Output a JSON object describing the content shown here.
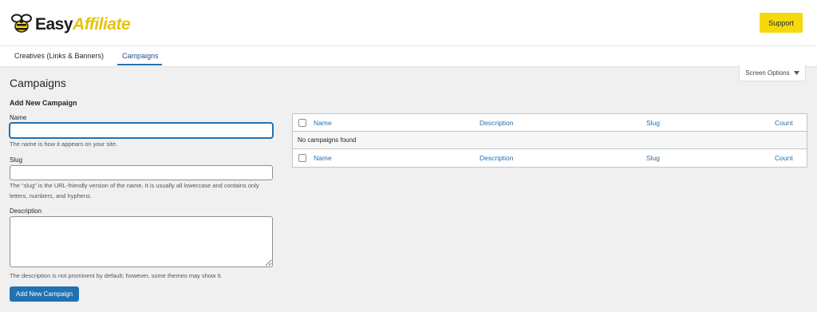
{
  "brand": {
    "logo_easy": "Easy",
    "logo_affiliate": "Affiliate",
    "accent": "#f5d90a",
    "link_color": "#2271b1"
  },
  "header": {
    "support_label": "Support"
  },
  "tabs": [
    {
      "label": "Creatives (Links & Banners)",
      "active": false
    },
    {
      "label": "Campaigns",
      "active": true
    }
  ],
  "screen_options": {
    "label": "Screen Options",
    "icon": "caret-down-icon"
  },
  "page": {
    "title": "Campaigns"
  },
  "form": {
    "title": "Add New Campaign",
    "name_label": "Name",
    "name_value": "",
    "name_help": "The name is how it appears on your site.",
    "slug_label": "Slug",
    "slug_value": "",
    "slug_help": "The “slug” is the URL-friendly version of the name. It is usually all lowercase and contains only letters, numbers, and hyphens.",
    "description_label": "Description",
    "description_value": "",
    "description_help": "The description is not prominent by default; however, some themes may show it.",
    "submit_label": "Add New Campaign"
  },
  "table": {
    "columns": [
      "Name",
      "Description",
      "Slug",
      "Count"
    ],
    "empty_message": "No campaigns found"
  }
}
